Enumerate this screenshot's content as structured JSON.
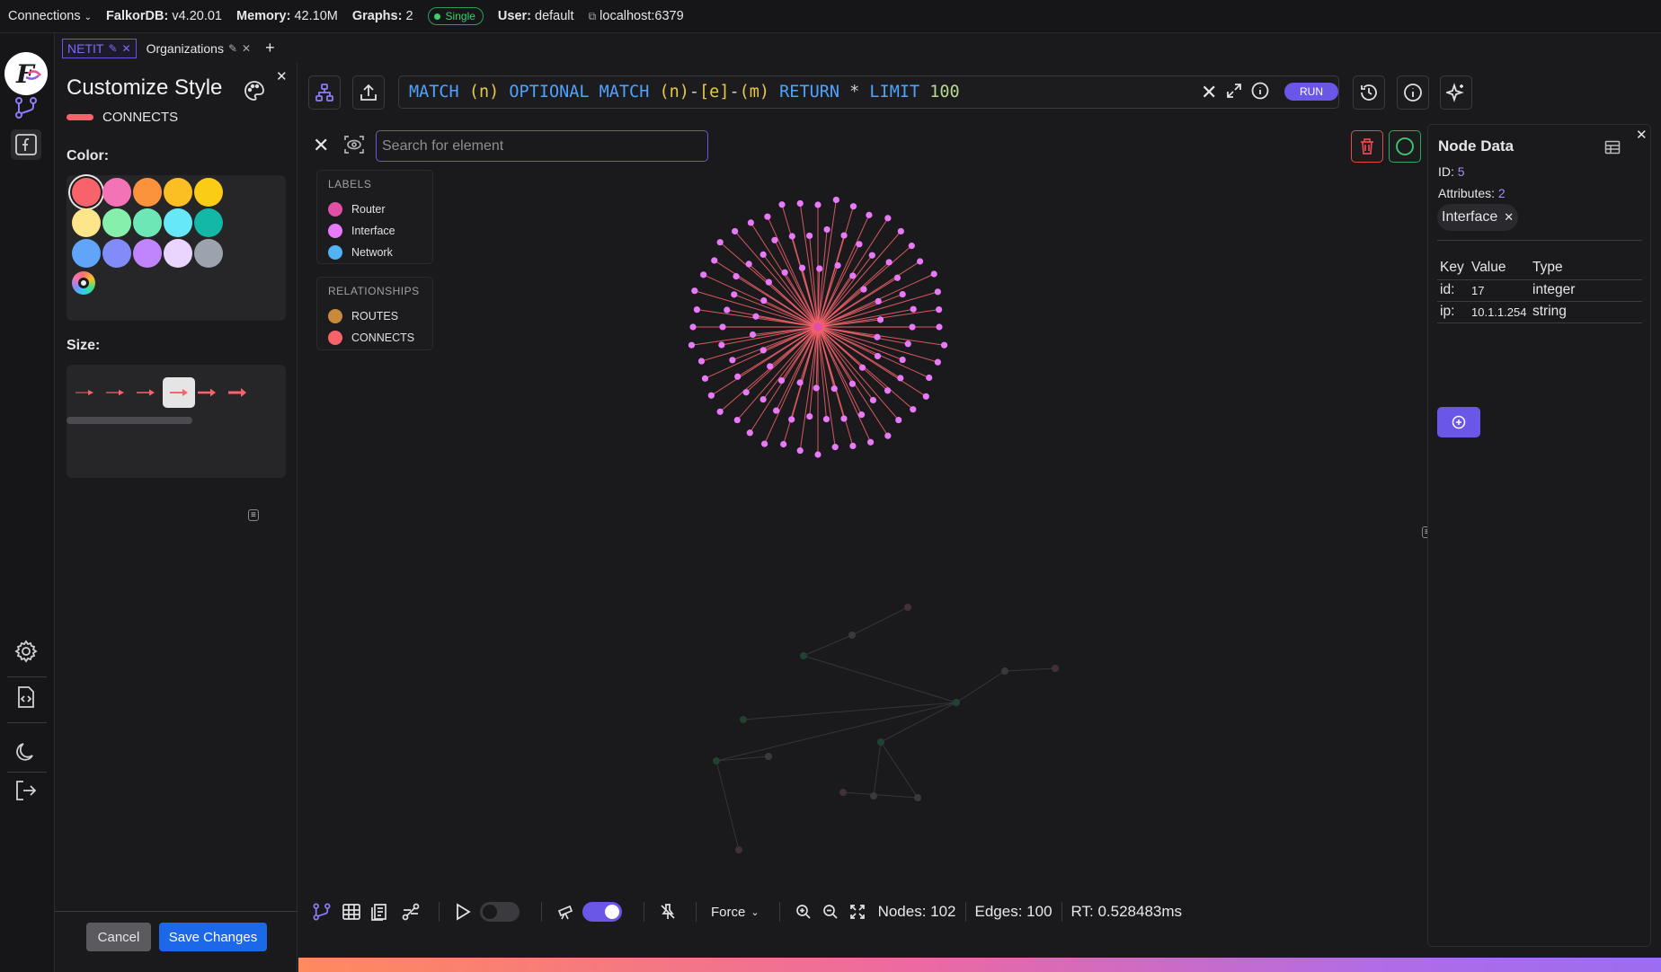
{
  "topbar": {
    "connections": "Connections",
    "version_label": "FalkorDB:",
    "version": "v4.20.01",
    "memory_label": "Memory:",
    "memory": "42.10M",
    "graphs_label": "Graphs:",
    "graphs": "2",
    "mode_badge": "Single",
    "user_label": "User:",
    "user": "default",
    "host": "localhost:6379"
  },
  "tabs": [
    {
      "label": "NETIT",
      "active": true
    },
    {
      "label": "Organizations",
      "active": false
    }
  ],
  "style_panel": {
    "title": "Customize Style",
    "relationship": "CONNECTS",
    "color_label": "Color:",
    "size_label": "Size:",
    "cancel": "Cancel",
    "save": "Save Changes",
    "palette": [
      "#f8636b",
      "#f472b6",
      "#fb923c",
      "#fbbf24",
      "#facc15",
      "#fde68a",
      "#86efac",
      "#6ee7b7",
      "#67e8f9",
      "#14b8a6",
      "#60a5fa",
      "#818cf8",
      "#c084fc",
      "#e9d5ff",
      "#9ca3af"
    ],
    "selected_color": "#f8636b",
    "selected_size_index": 3
  },
  "query": {
    "match1": "MATCH",
    "n1": "(n)",
    "optional": "OPTIONAL MATCH",
    "n2": "(n)",
    "dash1": "-",
    "e": "[e]",
    "dash2": "-",
    "m": "(m)",
    "ret": "RETURN",
    "star": "*",
    "limit": "LIMIT",
    "limit_value": "100",
    "run": "RUN"
  },
  "search": {
    "placeholder": "Search for element"
  },
  "legend": {
    "labels_title": "LABELS",
    "labels": [
      {
        "name": "Router",
        "color": "#e34fa6"
      },
      {
        "name": "Interface",
        "color": "#e879f9"
      },
      {
        "name": "Network",
        "color": "#4fb3f6"
      }
    ],
    "relationships_title": "RELATIONSHIPS",
    "relationships": [
      {
        "name": "ROUTES",
        "color": "#c98a3c"
      },
      {
        "name": "CONNECTS",
        "color": "#f8636b"
      }
    ]
  },
  "node_data": {
    "title": "Node Data",
    "id_label": "ID:",
    "id": "5",
    "attributes_label": "Attributes:",
    "attributes": "2",
    "label_chip": "Interface",
    "headers": [
      "Key",
      "Value",
      "Type"
    ],
    "rows": [
      {
        "key": "id:",
        "value": "17",
        "type": "integer"
      },
      {
        "key": "ip:",
        "value": "10.1.1.254",
        "type": "string"
      }
    ]
  },
  "toolbar": {
    "layout": "Force",
    "nodes": "Nodes: 102",
    "edges": "Edges: 100",
    "rt": "RT: 0.528483ms"
  }
}
